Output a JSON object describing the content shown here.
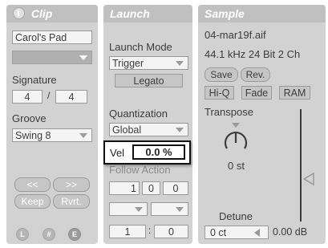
{
  "clip": {
    "title": "Clip",
    "name": "Carol's Pad",
    "signature_label": "Signature",
    "sig_num": "4",
    "sig_sep": "/",
    "sig_den": "4",
    "groove_label": "Groove",
    "groove_value": "Swing 8",
    "nudge_back": "<<",
    "nudge_fwd": ">>",
    "keep": "Keep",
    "revert": "Rvrt."
  },
  "launch": {
    "title": "Launch",
    "mode_label": "Launch Mode",
    "mode_value": "Trigger",
    "legato": "Legato",
    "quant_label": "Quantization",
    "quant_value": "Global",
    "vel_label": "Vel",
    "vel_value": "0.0 %",
    "follow_label": "Follow Action",
    "follow_time": [
      "1",
      "0",
      "0"
    ],
    "chance_a": "1",
    "chance_sep": ":",
    "chance_b": "0"
  },
  "sample": {
    "title": "Sample",
    "filename": "04-mar19f.aif",
    "format": "44.1 kHz 24 Bit 2 Ch",
    "save": "Save",
    "rev": "Rev.",
    "hiq": "Hi-Q",
    "fade": "Fade",
    "ram": "RAM",
    "transpose_label": "Transpose",
    "transpose_value": "0 st",
    "detune_label": "Detune",
    "detune_value": "0 ct",
    "gain_value": "0.00 dB"
  },
  "colors": {
    "panel": "#d2d2d2",
    "header": "#c0c0c0",
    "field": "#f4f4f4",
    "highlight_border": "#000000"
  }
}
